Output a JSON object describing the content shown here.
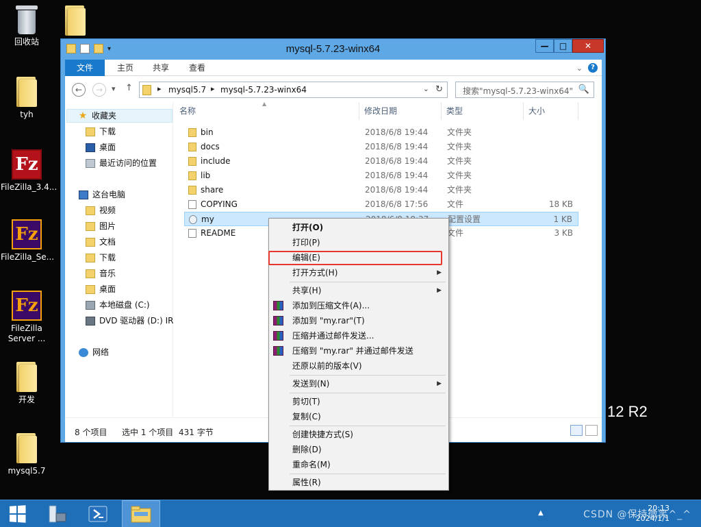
{
  "desktop": {
    "icons": [
      {
        "label": "回收站",
        "icon": "recycle-bin-icon"
      },
      {
        "label": "tyh",
        "icon": "folder-icon"
      },
      {
        "label": "FileZilla_3.4...",
        "icon": "filezilla-icon"
      },
      {
        "label": "FileZilla_Se...",
        "icon": "filezilla-server-icon"
      },
      {
        "label": "FileZilla Server ...",
        "icon": "filezilla-server-icon"
      },
      {
        "label": "开发",
        "icon": "folder-icon"
      },
      {
        "label": "mysql5.7",
        "icon": "folder-icon"
      }
    ],
    "watermark": "12 R2"
  },
  "window": {
    "title": "mysql-5.7.23-winx64",
    "buttons": {
      "minimize": "—",
      "maximize": "□",
      "close": "✕"
    },
    "ribbon": {
      "tabs": [
        "文件",
        "主页",
        "共享",
        "查看"
      ],
      "expand": "⌄",
      "help": "?"
    },
    "address": {
      "crumbs": [
        "mysql5.7",
        "mysql-5.7.23-winx64"
      ],
      "separator": "▸",
      "dropdown": "⌄",
      "refresh": "↻"
    },
    "search": {
      "placeholder": "搜索\"mysql-5.7.23-winx64\"",
      "icon": "🔍"
    },
    "nav": {
      "favorites": "收藏夹",
      "favorites_items": [
        "下载",
        "桌面",
        "最近访问的位置"
      ],
      "this_pc": "这台电脑",
      "pc_items": [
        "视频",
        "图片",
        "文档",
        "下载",
        "音乐",
        "桌面",
        "本地磁盘 (C:)",
        "DVD 驱动器 (D:) IR"
      ],
      "network": "网络"
    },
    "columns": [
      "名称",
      "修改日期",
      "类型",
      "大小"
    ],
    "files": [
      {
        "name": "bin",
        "date": "2018/6/8 19:44",
        "type": "文件夹",
        "size": ""
      },
      {
        "name": "docs",
        "date": "2018/6/8 19:44",
        "type": "文件夹",
        "size": ""
      },
      {
        "name": "include",
        "date": "2018/6/8 19:44",
        "type": "文件夹",
        "size": ""
      },
      {
        "name": "lib",
        "date": "2018/6/8 19:44",
        "type": "文件夹",
        "size": ""
      },
      {
        "name": "share",
        "date": "2018/6/8 19:44",
        "type": "文件夹",
        "size": ""
      },
      {
        "name": "COPYING",
        "date": "2018/6/8 17:56",
        "type": "文件",
        "size": "18 KB"
      },
      {
        "name": "my",
        "date": "2018/6/8 18:37",
        "type": "配置设置",
        "size": "1 KB"
      },
      {
        "name": "README",
        "date": "",
        "type": "文件",
        "size": "3 KB"
      }
    ],
    "status": {
      "count": "8 个项目",
      "selected": "选中 1 个项目",
      "bytes": "431 字节"
    }
  },
  "context_menu": {
    "items": [
      {
        "label": "打开(O)",
        "bold": true
      },
      {
        "label": "打印(P)"
      },
      {
        "label": "编辑(E)"
      },
      {
        "label": "打开方式(H)",
        "submenu": true
      },
      {
        "label": "共享(H)",
        "submenu": true
      },
      {
        "label": "添加到压缩文件(A)...",
        "icon": "winrar-icon"
      },
      {
        "label": "添加到 \"my.rar\"(T)",
        "icon": "winrar-icon"
      },
      {
        "label": "压缩并通过邮件发送...",
        "icon": "winrar-icon"
      },
      {
        "label": "压缩到 \"my.rar\" 并通过邮件发送",
        "icon": "winrar-icon"
      },
      {
        "label": "还原以前的版本(V)"
      },
      {
        "label": "发送到(N)",
        "submenu": true
      },
      {
        "label": "剪切(T)"
      },
      {
        "label": "复制(C)"
      },
      {
        "label": "创建快捷方式(S)"
      },
      {
        "label": "删除(D)"
      },
      {
        "label": "重命名(M)"
      },
      {
        "label": "属性(R)"
      }
    ],
    "highlight_color": "#e5372c"
  },
  "taskbar": {
    "tray_text": "CSDN @保持微笑^_^",
    "time": "20:13",
    "date": "2024/1/1",
    "tray_arrow": "▲"
  }
}
